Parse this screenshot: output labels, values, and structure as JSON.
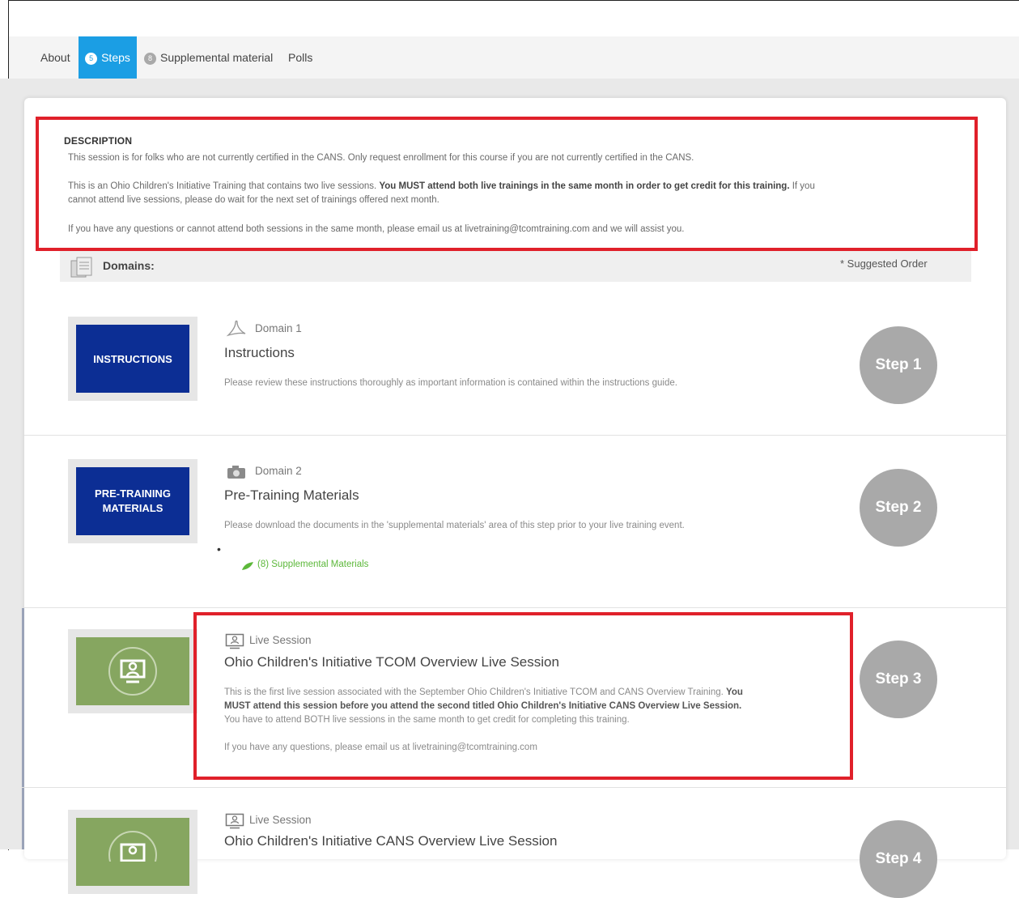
{
  "tabs": [
    {
      "label": "About"
    },
    {
      "label": "Steps",
      "badge": "5"
    },
    {
      "label": "Supplemental material",
      "badge": "8"
    },
    {
      "label": "Polls"
    }
  ],
  "description": {
    "title": "DESCRIPTION",
    "p1": "This session is for folks who are not currently certified in the CANS.  Only request enrollment for this course if you are not currently certified in the CANS.",
    "p2_a": "This is an Ohio Children's Initiative Training that contains two live sessions.  ",
    "p2_bold": "You MUST attend both live trainings in the same month in order to get credit for this training.",
    "p2_b": "  If you",
    "p2_c": "cannot attend live sessions, please do wait for the next set of trainings offered next month.",
    "p3": "If you have any questions or cannot attend both sessions in the same month, please email us at livetraining@tcomtraining.com and we will assist you."
  },
  "domains_header": {
    "label": "Domains:",
    "suggested": "* Suggested Order"
  },
  "domains": [
    {
      "thumb": "INSTRUCTIONS",
      "meta": "Domain 1",
      "title": "Instructions",
      "desc": "Please review these instructions thoroughly as important information is contained within the instructions guide.",
      "step": "Step 1"
    },
    {
      "thumb_l1": "PRE-TRAINING",
      "thumb_l2": "MATERIALS",
      "meta": "Domain 2",
      "title": "Pre-Training Materials",
      "desc": "Please download the documents in the 'supplemental materials' area of this step prior to your live training event.",
      "link": "(8) Supplemental Materials",
      "step": "Step 2"
    },
    {
      "meta": "Live Session",
      "title": "Ohio Children's Initiative TCOM Overview Live Session",
      "desc_a": "This is the first live session associated with the September Ohio Children's Initiative TCOM and CANS Overview Training.  ",
      "desc_b1": "You",
      "desc_b2": "MUST attend this session before you attend the second titled Ohio Children's Initiative CANS Overview Live Session.",
      "desc_c": "You have to attend BOTH live sessions in the same month to get credit for completing this training.",
      "desc_d": "If you have any questions, please email us at livetraining@tcomtraining.com",
      "step": "Step 3"
    },
    {
      "meta": "Live Session",
      "title": "Ohio Children's Initiative CANS Overview Live Session",
      "step": "Step 4"
    }
  ],
  "colors": {
    "accent": "#1b9ee4",
    "highlight": "#e0202a",
    "step_circle": "#a9a9a9",
    "thumb_blue": "#0c2e94",
    "thumb_green": "#86a660",
    "link_green": "#5cb83a"
  }
}
